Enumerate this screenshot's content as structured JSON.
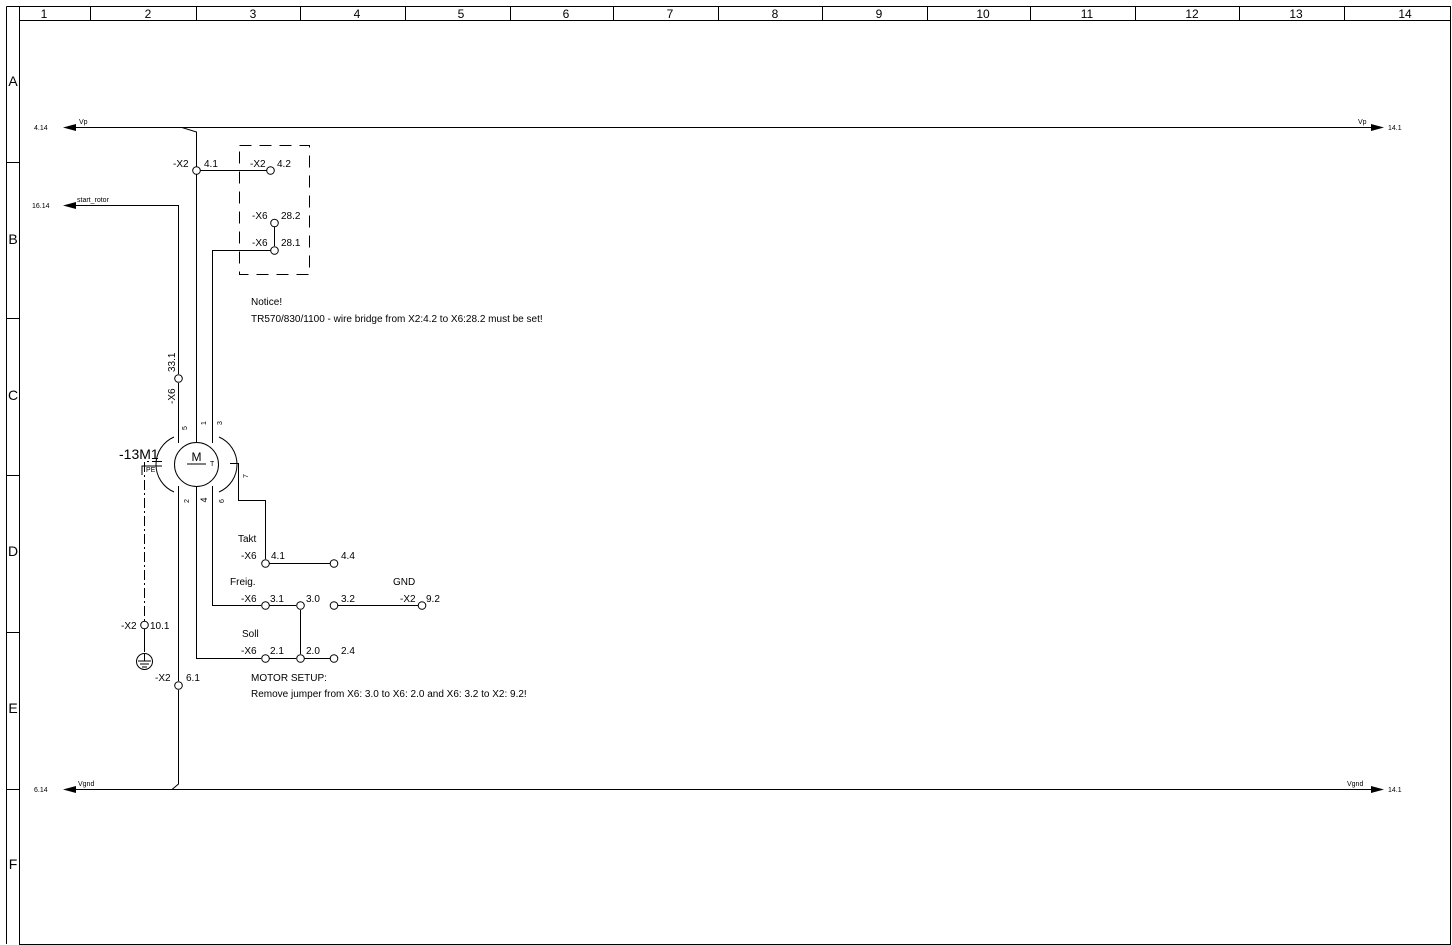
{
  "frame": {
    "columns": [
      "1",
      "2",
      "3",
      "4",
      "5",
      "6",
      "7",
      "8",
      "9",
      "10",
      "11",
      "12",
      "13",
      "14"
    ],
    "rows": [
      "A",
      "B",
      "C",
      "D",
      "E",
      "F"
    ]
  },
  "rails": {
    "vp": {
      "left_ref": "4.14",
      "left_label": "Vp",
      "right_label": "Vp",
      "right_ref": "14.1"
    },
    "vgnd": {
      "left_ref": "6.14",
      "left_label": "Vgnd",
      "right_label": "Vgnd",
      "right_ref": "14.1"
    }
  },
  "signal": {
    "ref": "16.14",
    "label": "start_rotor"
  },
  "terminals": {
    "x2_41": {
      "strip": "-X2",
      "pin": "4.1"
    },
    "x2_42": {
      "strip": "-X2",
      "pin": "4.2"
    },
    "x6_282": {
      "strip": "-X6",
      "pin": "28.2"
    },
    "x6_281": {
      "strip": "-X6",
      "pin": "28.1"
    },
    "x6_331": {
      "strip": "-X6",
      "pin": "33.1"
    },
    "x6_41": {
      "strip": "-X6",
      "pin": "4.1",
      "pin_b": "4.4"
    },
    "x6_31": {
      "strip": "-X6",
      "pin": "3.1",
      "pin_b": "3.0",
      "pin_c": "3.2"
    },
    "x2_92": {
      "strip": "-X2",
      "pin": "9.2"
    },
    "x6_21": {
      "strip": "-X6",
      "pin": "2.1",
      "pin_b": "2.0",
      "pin_c": "2.4"
    },
    "x2_101": {
      "strip": "-X2",
      "pin": "10.1"
    },
    "x2_61": {
      "strip": "-X2",
      "pin": "6.1"
    }
  },
  "motor": {
    "tag": "-13M1",
    "symbol": "M",
    "tacho": "T",
    "pe": "PE",
    "wires": {
      "w5": "5",
      "w1": "1",
      "w3": "3",
      "w7": "7",
      "w2": "2",
      "w4": "4",
      "w6": "6"
    }
  },
  "signal_labels": {
    "takt": "Takt",
    "freig": "Freig.",
    "gnd": "GND",
    "soll": "Soll"
  },
  "notes": {
    "notice_title": "Notice!",
    "notice_text": "TR570/830/1100 - wire bridge from X2:4.2 to X6:28.2 must be set!",
    "setup_title": "MOTOR SETUP:",
    "setup_text": "Remove jumper from X6: 3.0 to X6: 2.0 and X6: 3.2 to X2: 9.2!"
  }
}
